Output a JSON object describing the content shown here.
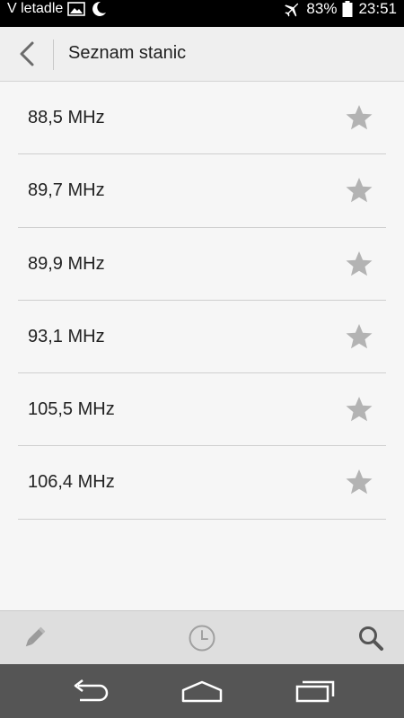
{
  "status_bar": {
    "mode_label": "V letadle",
    "battery": "83%",
    "time": "23:51",
    "icons": [
      "image-icon",
      "moon-icon",
      "airplane-icon",
      "battery-icon"
    ]
  },
  "header": {
    "title": "Seznam stanic",
    "back_icon": "chevron-left-icon"
  },
  "stations": [
    {
      "label": "88,5 MHz",
      "favorite": false
    },
    {
      "label": "89,7 MHz",
      "favorite": false
    },
    {
      "label": "89,9 MHz",
      "favorite": false
    },
    {
      "label": "93,1 MHz",
      "favorite": false
    },
    {
      "label": "105,5 MHz",
      "favorite": false
    },
    {
      "label": "106,4 MHz",
      "favorite": false
    }
  ],
  "toolbar": {
    "icons": [
      "pencil-icon",
      "clock-icon",
      "search-icon"
    ]
  },
  "navigation": {
    "icons": [
      "back-icon",
      "home-icon",
      "recent-apps-icon"
    ]
  },
  "colors": {
    "status_bar": "#000000",
    "header_bg": "#efefef",
    "list_bg": "#f6f6f6",
    "star_inactive": "#b3b3b3",
    "toolbar_bg": "#dedede",
    "nav_bar": "#555555"
  }
}
